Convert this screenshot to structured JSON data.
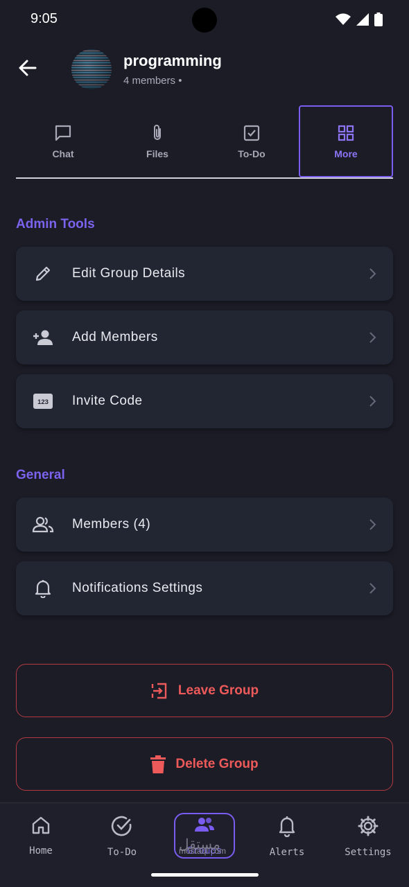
{
  "status_bar": {
    "time": "9:05"
  },
  "header": {
    "group_name": "programming",
    "members_text": "4 members •"
  },
  "tabs": [
    {
      "label": "Chat",
      "icon": "chat-bubble-icon",
      "active": false
    },
    {
      "label": "Files",
      "icon": "paperclip-icon",
      "active": false
    },
    {
      "label": "To-Do",
      "icon": "checkbox-icon",
      "active": false
    },
    {
      "label": "More",
      "icon": "grid-icon",
      "active": true
    }
  ],
  "admin_tools": {
    "title": "Admin Tools",
    "items": [
      {
        "label": "Edit Group Details",
        "icon": "pencil-icon"
      },
      {
        "label": "Add Members",
        "icon": "person-add-icon"
      },
      {
        "label": "Invite Code",
        "icon": "number-badge-icon",
        "badge_text": "123"
      }
    ]
  },
  "general": {
    "title": "General",
    "items": [
      {
        "label": "Members (4)",
        "icon": "people-icon"
      },
      {
        "label": "Notifications Settings",
        "icon": "bell-icon"
      }
    ]
  },
  "actions": {
    "leave_label": "Leave Group",
    "delete_label": "Delete Group"
  },
  "bottom_nav": [
    {
      "label": "Home",
      "icon": "home-icon",
      "active": false
    },
    {
      "label": "To-Do",
      "icon": "check-circle-icon",
      "active": false
    },
    {
      "label": "Groups",
      "icon": "groups-icon",
      "active": true
    },
    {
      "label": "Alerts",
      "icon": "bell-icon",
      "active": false
    },
    {
      "label": "Settings",
      "icon": "gear-icon",
      "active": false
    }
  ],
  "watermark": {
    "arabic": "مستقل",
    "latin": "mostaql.com"
  },
  "colors": {
    "background": "#1c1c27",
    "card": "#222633",
    "accent": "#7a5cf0",
    "danger": "#ee5a5a"
  }
}
